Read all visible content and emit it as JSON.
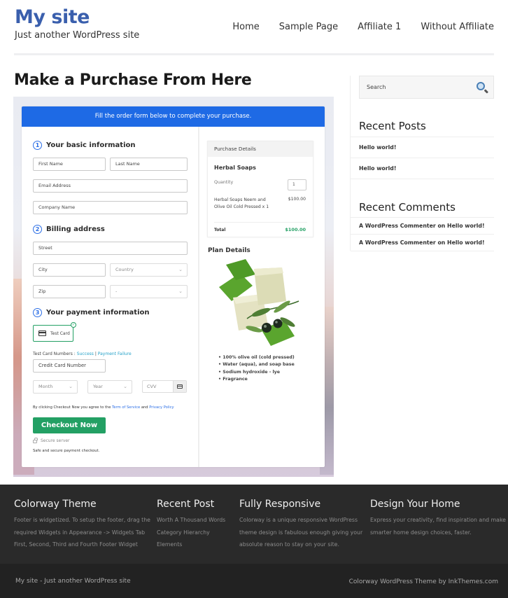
{
  "header": {
    "site_title": "My site",
    "tagline": "Just another WordPress site",
    "nav": [
      {
        "label": "Home"
      },
      {
        "label": "Sample Page"
      },
      {
        "label": "Affiliate 1"
      },
      {
        "label": "Without Affiliate"
      }
    ]
  },
  "main": {
    "page_title": "Make a Purchase From Here",
    "form": {
      "banner": "Fill the order form below to complete your purchase.",
      "step1": {
        "num": "1",
        "title": "Your basic information"
      },
      "first_name": "First Name",
      "last_name": "Last Name",
      "email": "Email Address",
      "company": "Company Name",
      "step2": {
        "num": "2",
        "title": "Billing address"
      },
      "street": "Street",
      "city": "City",
      "country": "Country",
      "zip": "Zip",
      "state": "-",
      "step3": {
        "num": "3",
        "title": "Your payment information"
      },
      "test_card": "Test Card",
      "test_card_numbers_label": "Test Card Numbers :",
      "success_link": "Success",
      "separator": "|",
      "failure_link": "Payment Failure",
      "credit_card": "Credit Card Number",
      "month": "Month",
      "year": "Year",
      "cvv": "CVV",
      "agree_prefix": "By clicking Checkout Now you agree to the",
      "terms_link": "Term of Service",
      "agree_and": "and",
      "privacy_link": "Privacy Policy",
      "checkout_button": "Checkout Now",
      "secure_server": "Secure server",
      "safe_text": "Safe and secure payment checkout."
    },
    "purchase_details": {
      "heading": "Purchase Details",
      "product": "Herbal Soaps",
      "quantity_label": "Quantity",
      "quantity": "1",
      "item": "Herbal Soaps Neem and Olive Oil Cold Pressed x 1",
      "item_price": "$100.00",
      "total_label": "Total",
      "total": "$100.00"
    },
    "plan": {
      "title": "Plan Details",
      "features": [
        "100% olive oil (cold pressed)",
        "Water (aqua), and soap base",
        "Sodium hydroxide - lye",
        "Fragrance"
      ]
    }
  },
  "sidebar": {
    "search_placeholder": "Search",
    "recent_posts_title": "Recent Posts",
    "recent_posts": [
      "Hello world!",
      "Hello world!"
    ],
    "recent_comments_title": "Recent Comments",
    "recent_comments": [
      "A WordPress Commenter on Hello world!",
      "A WordPress Commenter on Hello world!"
    ]
  },
  "footer": {
    "cols": [
      {
        "title": "Colorway Theme",
        "lines": [
          "Footer is widgetized. To setup the footer, drag the",
          "required Widgets in Appearance -> Widgets Tab",
          "First, Second, Third and Fourth Footer Widget"
        ]
      },
      {
        "title": "Recent Post",
        "lines": [
          "Worth A Thousand Words",
          "Category Hierarchy",
          "Elements"
        ]
      },
      {
        "title": "Fully Responsive",
        "lines": [
          "Colorway is a unique responsive WordPress",
          "theme design is fabulous enough giving your",
          "absolute reason to stay on your site."
        ]
      },
      {
        "title": "Design Your Home",
        "lines": [
          "Express your creativity, find inspiration and make",
          "smarter home design choices, faster."
        ]
      }
    ],
    "bottom_left": "My site - Just another WordPress site",
    "bottom_right": "Colorway WordPress Theme by InkThemes.com"
  },
  "colors": {
    "brand_blue": "#3a5fad",
    "banner_blue": "#1e6ae5",
    "checkout_green": "#23a064",
    "link_teal": "#24a1c8",
    "footer_bg": "#2a2a2a"
  }
}
